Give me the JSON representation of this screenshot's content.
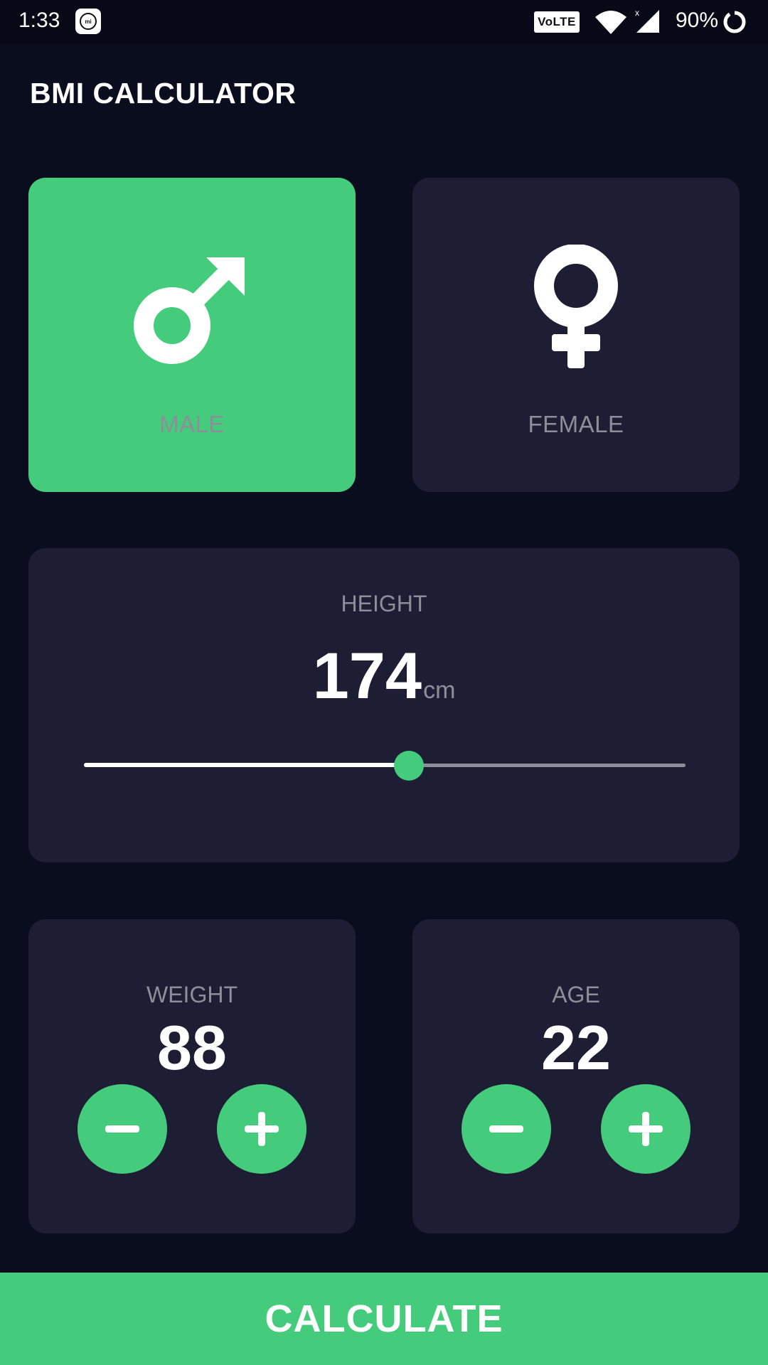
{
  "status_bar": {
    "time": "1:33",
    "network_badge": "VoLTE",
    "battery_percent": "90%",
    "icons": [
      "mi-app-icon",
      "wifi-icon",
      "cell-signal-icon",
      "battery-ring-icon"
    ]
  },
  "app": {
    "title": "BMI CALCULATOR"
  },
  "gender": {
    "male_label": "MALE",
    "female_label": "FEMALE",
    "selected": "male",
    "icons": [
      "male-symbol-icon",
      "female-symbol-icon"
    ]
  },
  "height": {
    "label": "HEIGHT",
    "value": "174",
    "unit": "cm",
    "slider_fraction": 0.54
  },
  "weight": {
    "label": "WEIGHT",
    "value": "88",
    "icons": [
      "minus-icon",
      "plus-icon"
    ]
  },
  "age": {
    "label": "AGE",
    "value": "22",
    "icons": [
      "minus-icon",
      "plus-icon"
    ]
  },
  "calculate": {
    "label": "CALCULATE"
  },
  "colors": {
    "background": "#0a0d1e",
    "card": "#1d1e33",
    "accent": "#44cc7c",
    "muted_text": "#8d8e98"
  }
}
